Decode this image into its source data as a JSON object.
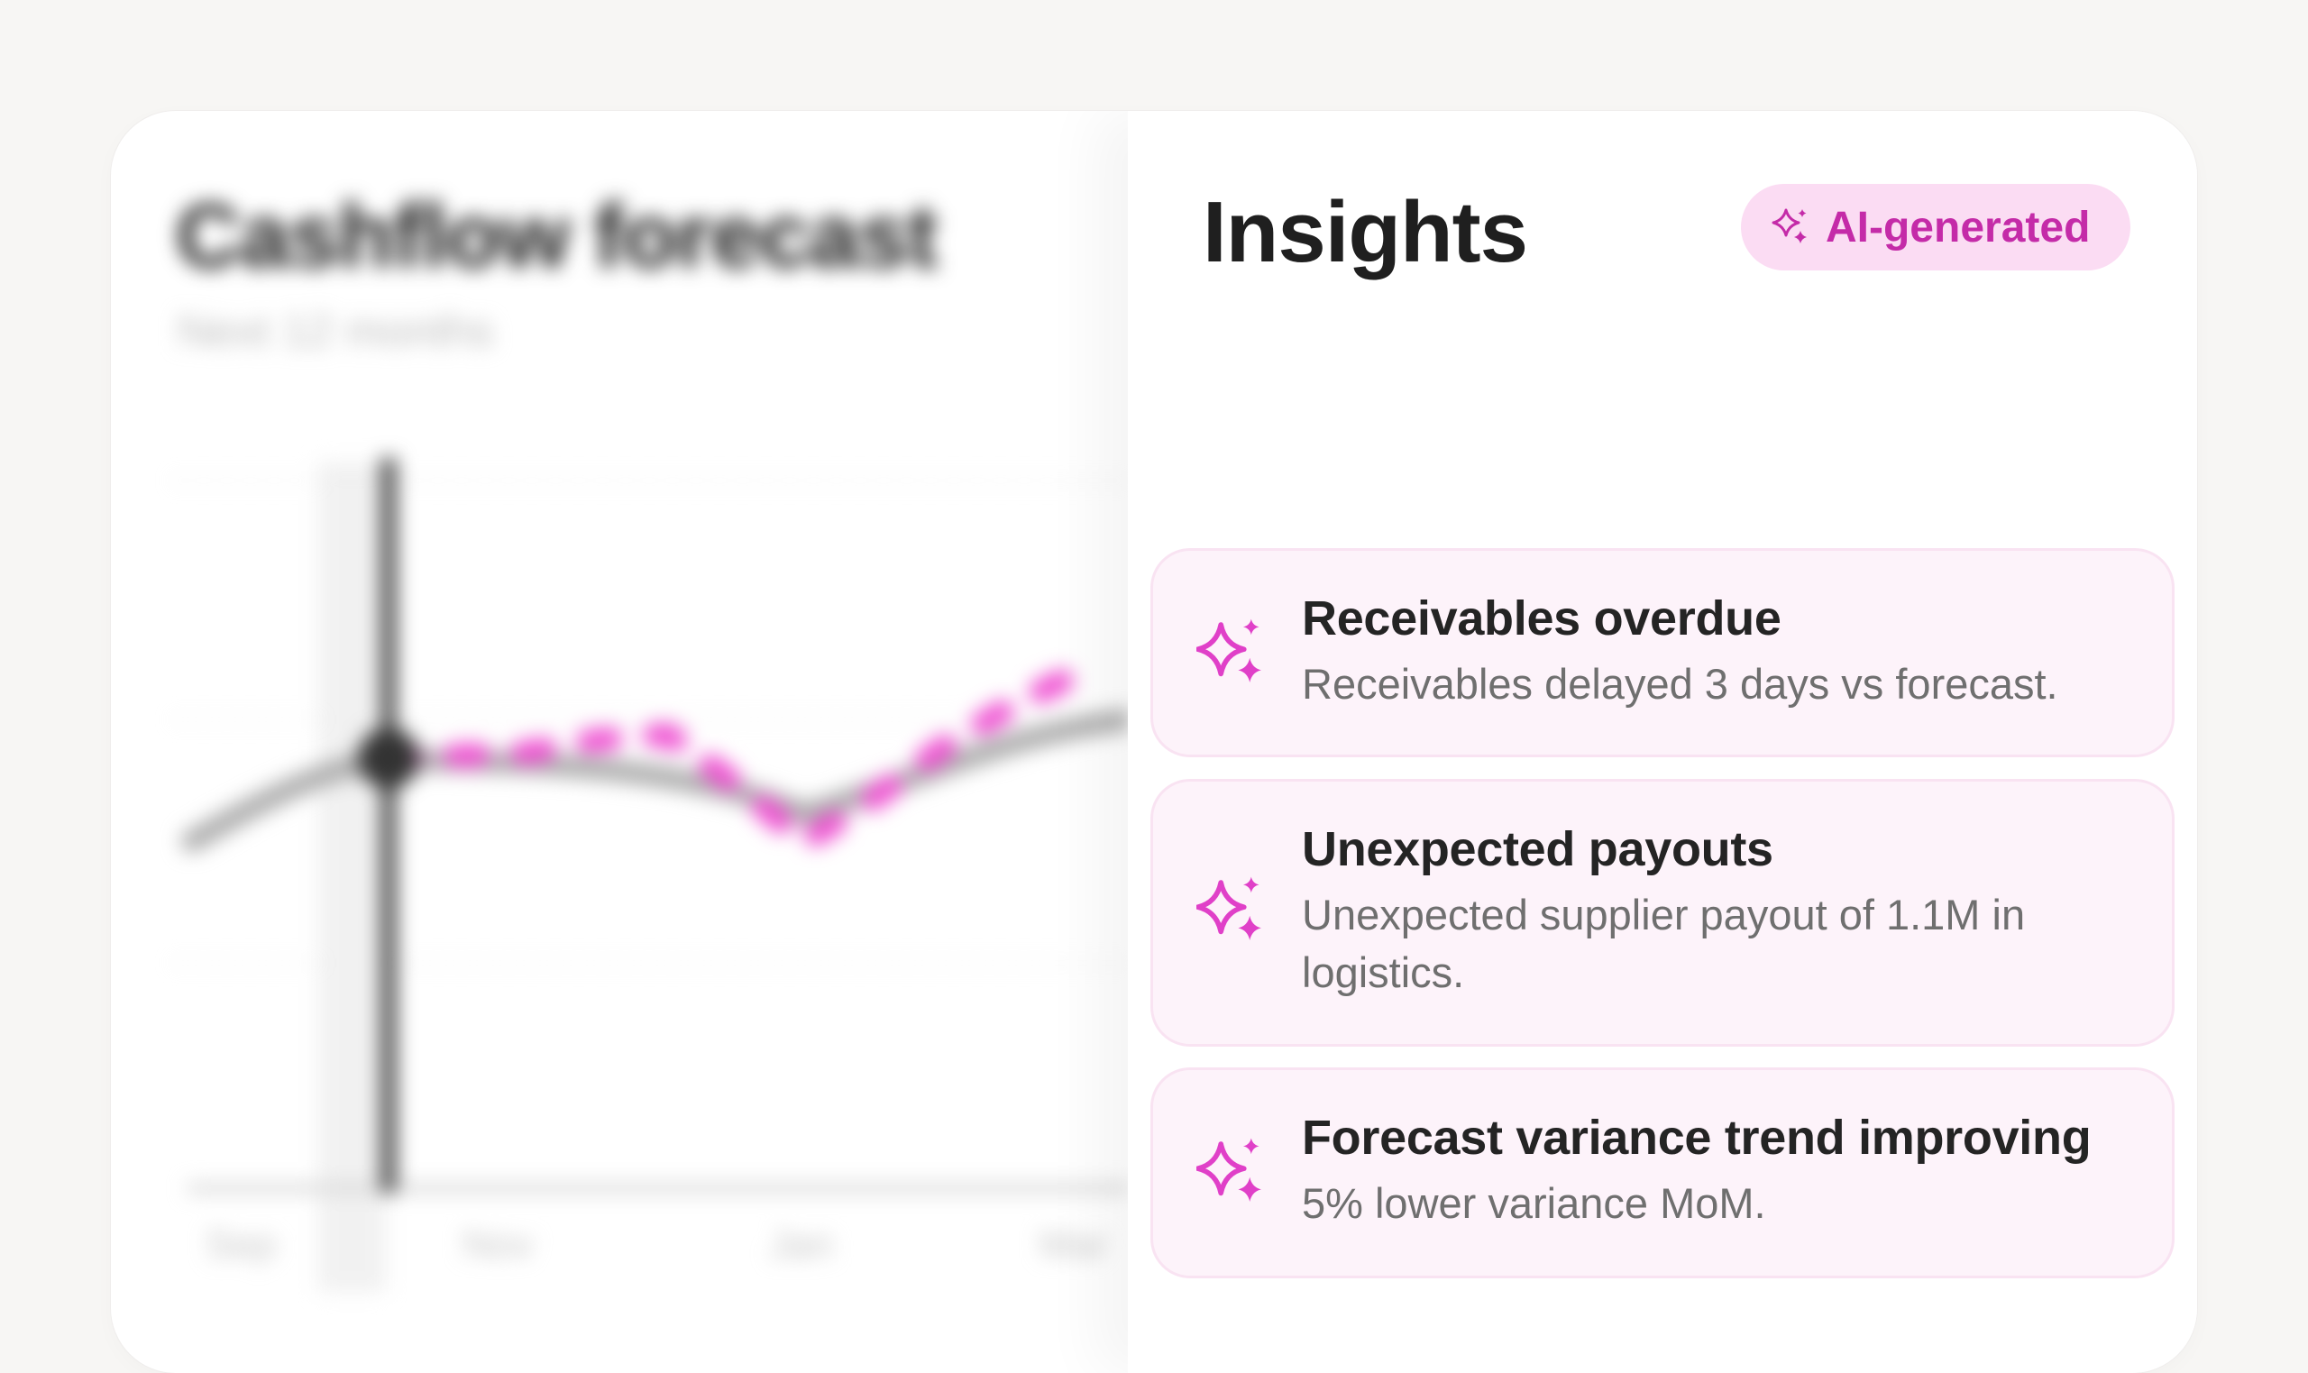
{
  "chart_panel": {
    "title": "Cashflow forecast",
    "subtitle": "Next 12 months",
    "x_ticks": [
      "Sep",
      "Nov",
      "Jan",
      "Mar"
    ]
  },
  "insights": {
    "title": "Insights",
    "badge": {
      "label": "AI-generated",
      "icon": "sparkles-icon"
    },
    "items": [
      {
        "title": "Receivables overdue",
        "description": "Receivables delayed 3 days vs forecast.",
        "icon": "sparkles-icon"
      },
      {
        "title": "Unexpected payouts",
        "description": "Unexpected supplier payout of 1.1M in logistics.",
        "icon": "sparkles-icon"
      },
      {
        "title": "Forecast variance trend improving",
        "description": "5% lower variance MoM.",
        "icon": "sparkles-icon"
      }
    ]
  },
  "colors": {
    "accent": "#e040c8",
    "badge_bg": "#fbdcf3",
    "card_bg": "#fdf3fa",
    "page_bg": "#f7f6f4"
  }
}
